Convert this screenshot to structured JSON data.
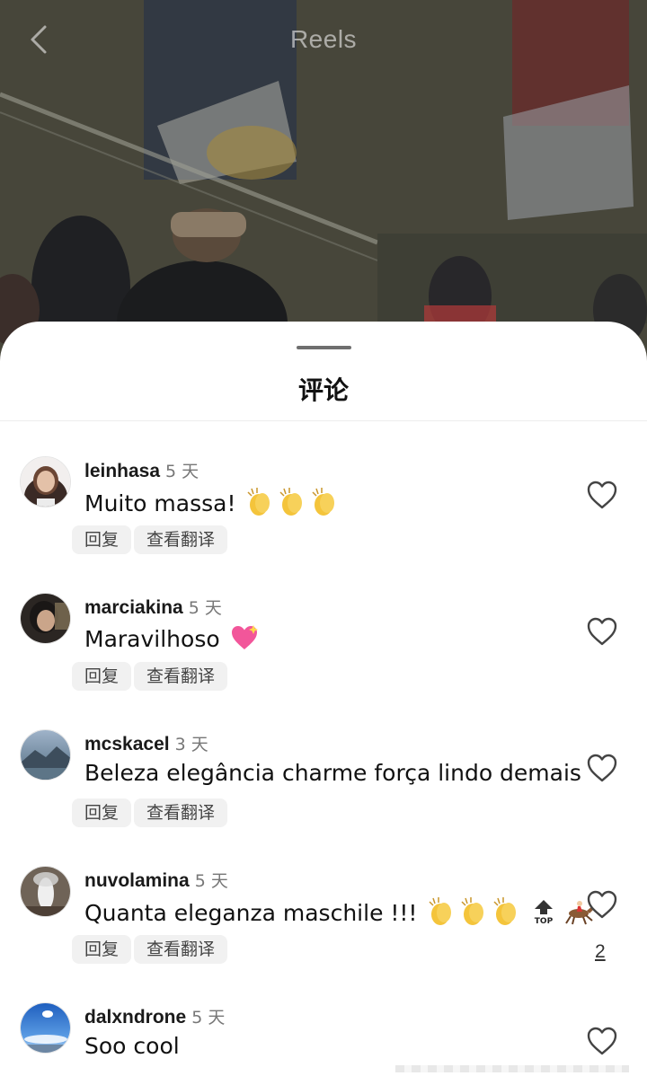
{
  "header": {
    "title": "Reels",
    "back_icon": "chevron-left-icon"
  },
  "sheet": {
    "title": "评论"
  },
  "comments": [
    {
      "user": "leinhasa",
      "time": "5 天",
      "text": "Muito massa!",
      "emoji": "clapping-hands x3",
      "like_count": ""
    },
    {
      "user": "marciakina",
      "time": "5 天",
      "text": "Maravilhoso",
      "emoji": "sparkling-heart",
      "like_count": ""
    },
    {
      "user": "mcskacel",
      "time": "3 天",
      "text": "Beleza elegância charme força lindo demais",
      "emoji": "",
      "like_count": ""
    },
    {
      "user": "nuvolamina",
      "time": "5 天",
      "text": "Quanta eleganza maschile !!!",
      "emoji": "clapping-hands x3, top-arrow, horse-racing",
      "like_count": "2"
    },
    {
      "user": "dalxndrone",
      "time": "5 天",
      "text": "Soo cool",
      "emoji": "",
      "like_count": ""
    }
  ],
  "actions": {
    "reply": "回复",
    "translate": "查看翻译"
  },
  "colors": {
    "accent_heart": "#444444",
    "pill_bg": "#f1f1f1",
    "handle": "#6f6f6f"
  }
}
